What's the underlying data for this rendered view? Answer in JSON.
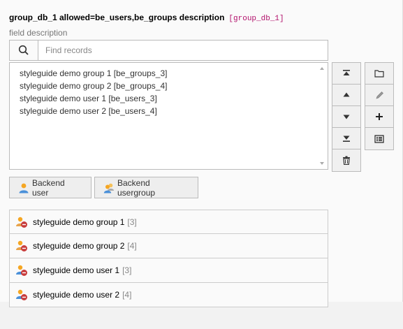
{
  "field": {
    "label": "group_db_1 allowed=be_users,be_groups description",
    "code": "[group_db_1]",
    "description": "field description"
  },
  "search": {
    "placeholder": "Find records",
    "icon": "search-icon"
  },
  "selected_items": [
    "styleguide demo group 1 [be_groups_3]",
    "styleguide demo group 2 [be_groups_4]",
    "styleguide demo user 1 [be_users_3]",
    "styleguide demo user 2 [be_users_4]"
  ],
  "move_buttons": [
    "move-top-icon",
    "move-up-icon",
    "move-down-icon",
    "move-bottom-icon",
    "trash-icon"
  ],
  "action_buttons": [
    "folder-icon",
    "pencil-icon",
    "plus-icon",
    "list-icon"
  ],
  "add_buttons": {
    "user": "Backend user",
    "usergroup": "Backend usergroup"
  },
  "records": [
    {
      "title": "styleguide demo group 1",
      "uid": "[3]"
    },
    {
      "title": "styleguide demo group 2",
      "uid": "[4]"
    },
    {
      "title": "styleguide demo user 1",
      "uid": "[3]"
    },
    {
      "title": "styleguide demo user 2",
      "uid": "[4]"
    }
  ],
  "colors": {
    "code": "#b2106b",
    "user_icon": "#f5a623",
    "badge_red": "#c83c3c"
  }
}
